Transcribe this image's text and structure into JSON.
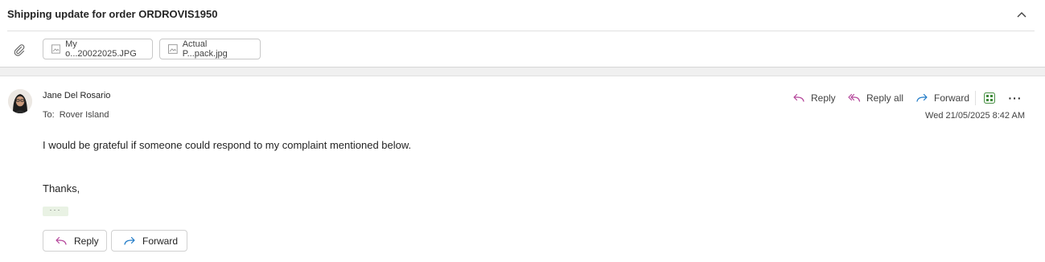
{
  "conversation": {
    "subject": "Shipping update for order ORDROVIS1950",
    "attachments": [
      {
        "name": "My o...20022025.JPG"
      },
      {
        "name": "Actual P...pack.jpg"
      }
    ]
  },
  "message": {
    "sender_name": "Jane Del Rosario",
    "to_label": "To:",
    "recipient": "Rover Island",
    "date": "Wed 21/05/2025 8:42 AM",
    "body": "I would be grateful if someone could respond to my complaint mentioned below.",
    "signoff": "Thanks,",
    "show_more": "···"
  },
  "actions": {
    "reply_label": "Reply",
    "reply_all_label": "Reply all",
    "forward_label": "Forward",
    "more_label": "···"
  },
  "footer_buttons": {
    "reply_label": "Reply",
    "forward_label": "Forward"
  },
  "colors": {
    "reply_icon": "#b4459a",
    "forward_icon": "#1f7ac7",
    "apps_icon": "#3f8a3a",
    "show_more_bg": "#e9f2e4"
  }
}
